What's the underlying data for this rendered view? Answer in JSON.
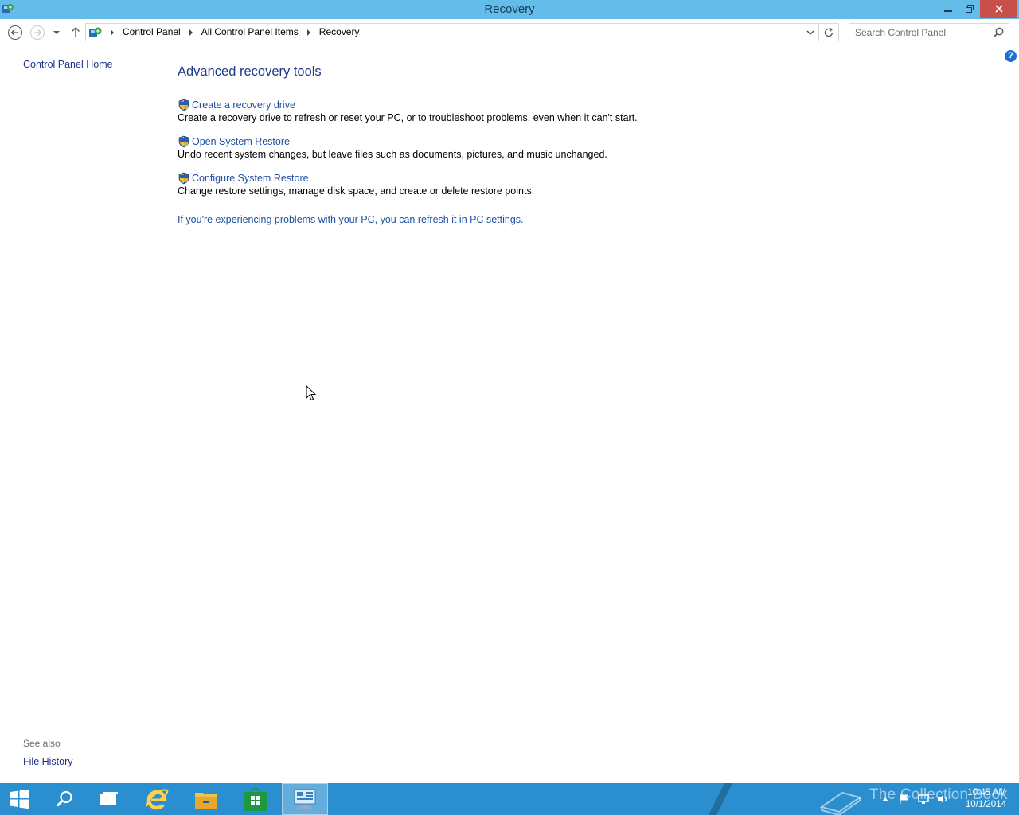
{
  "window": {
    "title": "Recovery"
  },
  "navigation": {
    "breadcrumbs": [
      "Control Panel",
      "All Control Panel Items",
      "Recovery"
    ],
    "search_placeholder": "Search Control Panel"
  },
  "left_pane": {
    "home_link": "Control Panel Home",
    "see_also_label": "See also",
    "see_also_links": [
      "File History"
    ]
  },
  "main": {
    "heading": "Advanced recovery tools",
    "tasks": [
      {
        "label": "Create a recovery drive",
        "description": "Create a recovery drive to refresh or reset your PC, or to troubleshoot problems, even when it can't start.",
        "icon": "uac-shield-icon"
      },
      {
        "label": "Open System Restore",
        "description": "Undo recent system changes, but leave files such as documents, pictures, and music unchanged.",
        "icon": "uac-shield-icon"
      },
      {
        "label": "Configure System Restore",
        "description": "Change restore settings, manage disk space, and create or delete restore points.",
        "icon": "uac-shield-icon"
      }
    ],
    "refresh_link": "If you're experiencing problems with your PC, you can refresh it in PC settings."
  },
  "help": {
    "label": "?"
  },
  "taskbar": {
    "watermark": "The Collection Book",
    "time": "10:45 AM",
    "date": "10/1/2014",
    "pinned": [
      "start-button",
      "search",
      "task-view",
      "internet-explorer",
      "file-explorer",
      "store",
      "control-panel"
    ]
  },
  "colors": {
    "titlebar": "#64bde9",
    "close_button": "#c7504a",
    "taskbar": "#2a8ecf",
    "link": "#1e50a2",
    "heading": "#1e3a8a"
  }
}
